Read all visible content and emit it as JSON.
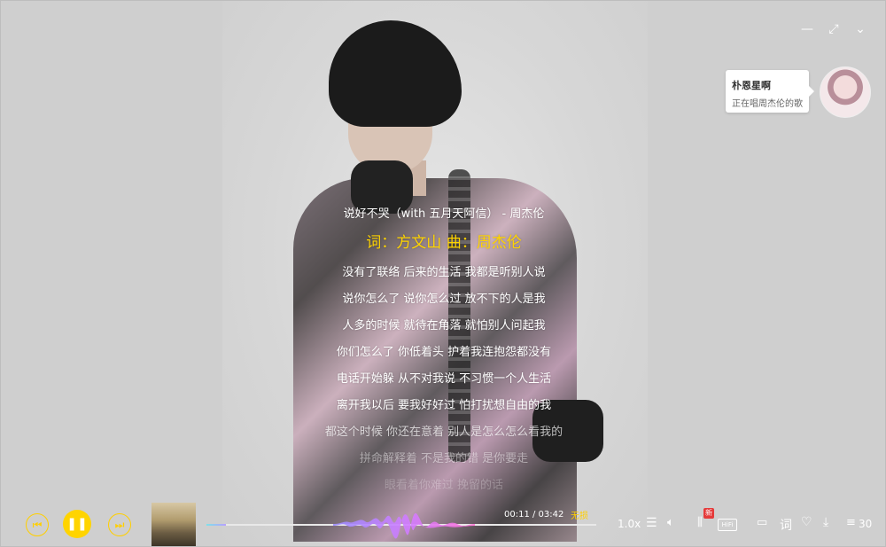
{
  "window": {
    "minimize_icon": "minimize-icon",
    "fullscreen_icon": "fullscreen-icon",
    "collapse_icon": "chevron-down-icon"
  },
  "share": {
    "user_name": "朴恩星啊",
    "status": "正在唱周杰伦的歌"
  },
  "lyrics": {
    "title_line": "说好不哭（with 五月天阿信） - 周杰伦",
    "active_line": "词：方文山  曲：周杰伦",
    "lines": [
      "没有了联络  后来的生活  我都是听别人说",
      "说你怎么了  说你怎么过  放不下的人是我",
      "人多的时候  就待在角落  就怕别人问起我",
      "你们怎么了  你低着头  护着我连抱怨都没有",
      "电话开始躲  从不对我说  不习惯一个人生活",
      "离开我以后  要我好好过  怕打扰想自由的我",
      "都这个时候  你还在意着  别人是怎么怎么看我的",
      "拼命解释着  不是我的错  是你要走",
      "眼看着你难过  挽留的话"
    ]
  },
  "player": {
    "time": "00:11 / 03:42",
    "quality": "无损",
    "progress_fraction": 0.05,
    "speed": "1.0x",
    "new_badge": "新",
    "hifi_label": "HiFi",
    "lyric_btn": "词",
    "playlist_count": "30",
    "accent_color": "#ffd400"
  }
}
